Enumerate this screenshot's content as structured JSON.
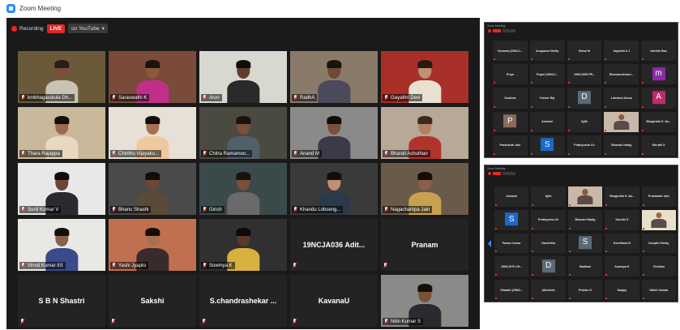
{
  "window": {
    "title": "Zoom Meeting"
  },
  "toolbar": {
    "recording_label": "Recording",
    "live_label": "LIVE",
    "stream_label": "on YouTube",
    "stream_caret": "▾"
  },
  "colors": {
    "accent": "#2D8CFF",
    "live": "#e02828",
    "active_border": "#e6d64a",
    "tile_bg": "#232323"
  },
  "gallery": [
    {
      "name": "kmbhagavatula Dh...",
      "video": true,
      "bg": "#6b5a3a",
      "skin": "#7a5036",
      "shirt": "#c9c2b6",
      "hair": "#2a1e16",
      "active": true
    },
    {
      "name": "Saraswathi K",
      "video": true,
      "bg": "#7a4a3a",
      "skin": "#8a5a3a",
      "shirt": "#c0308a",
      "hair": "#1a120e"
    },
    {
      "name": "Arun",
      "video": true,
      "bg": "#d8d8d0",
      "skin": "#5e3e2a",
      "shirt": "#2a2a2a",
      "hair": "#120c08"
    },
    {
      "name": "RadhA",
      "video": true,
      "bg": "#8a7a6a",
      "skin": "#6e4a34",
      "shirt": "#4a4a5a",
      "hair": "#1a140e"
    },
    {
      "name": "Gayathri Devi",
      "video": true,
      "bg": "#a83028",
      "skin": "#c09070",
      "shirt": "#e8e0d0",
      "hair": "#2a1a14"
    },
    {
      "name": "Thara Rajappa",
      "video": true,
      "bg": "#c9b89a",
      "skin": "#9a6a4a",
      "shirt": "#e8d8c0",
      "hair": "#140e0a"
    },
    {
      "name": "Chinthu Vijayaku...",
      "video": true,
      "bg": "#e6e0d6",
      "skin": "#a87050",
      "shirt": "#f0c8a0",
      "hair": "#140e0a"
    },
    {
      "name": "Chitra Ramamoo...",
      "video": true,
      "bg": "#4a4a40",
      "skin": "#7a5038",
      "shirt": "#50606a",
      "hair": "#1a120c"
    },
    {
      "name": "Anand M",
      "video": true,
      "bg": "#8a8a88",
      "skin": "#7a5038",
      "shirt": "#3a3a48",
      "hair": "#120c08"
    },
    {
      "name": "Bharati Achuthan",
      "video": true,
      "bg": "#b8a898",
      "skin": "#b48060",
      "shirt": "#b0342c",
      "hair": "#3a2a22"
    },
    {
      "name": "Sunil Kumar V",
      "video": true,
      "bg": "#e8e8e8",
      "skin": "#6a4634",
      "shirt": "#2a2a30",
      "hair": "#120c08"
    },
    {
      "name": "Bhanu Shashi",
      "video": true,
      "bg": "#4a4a4a",
      "skin": "#6a4834",
      "shirt": "#5a4a3a",
      "hair": "#120c08"
    },
    {
      "name": "Girish",
      "video": true,
      "bg": "#3a4a4a",
      "skin": "#7a5038",
      "shirt": "#6a6a6a",
      "hair": "#1a120c"
    },
    {
      "name": "Khandu Lobseng...",
      "video": true,
      "bg": "#3a3a3a",
      "skin": "#c09070",
      "shirt": "#2a3a4a",
      "hair": "#140e0a"
    },
    {
      "name": "Nagachampa Jain",
      "video": true,
      "bg": "#6a5a4a",
      "skin": "#8a6048",
      "shirt": "#c8a050",
      "hair": "#140e0a"
    },
    {
      "name": "Vinod Kumar IIS",
      "video": true,
      "bg": "#e8e8e4",
      "skin": "#8a6048",
      "shirt": "#3a4a8a",
      "hair": "#140e0a"
    },
    {
      "name": "Yashi Jyapto",
      "video": true,
      "bg": "#c07050",
      "skin": "#a87050",
      "shirt": "#3a2a2a",
      "hair": "#140e0a"
    },
    {
      "name": "Sowmya K",
      "video": true,
      "bg": "#303030",
      "skin": "#5a3a26",
      "shirt": "#d8b040",
      "hair": "#0e0a08"
    },
    {
      "name": "19NCJA036 Adit...",
      "video": false
    },
    {
      "name": "Pranam",
      "video": false
    },
    {
      "name": "S B N Shastri",
      "video": false
    },
    {
      "name": "Sakshi",
      "video": false
    },
    {
      "name": "S.chandrashekar ...",
      "video": false
    },
    {
      "name": "KavanaU",
      "video": false
    },
    {
      "name": "Nitin Kumar S",
      "video": true,
      "bg": "#8a8a88",
      "skin": "#7a5038",
      "shirt": "#2a2a30",
      "hair": "#140e0a"
    }
  ],
  "thumbnails": [
    {
      "title": "Zoom Meeting",
      "tiles": [
        {
          "name": "Suvarna (20NCJ...",
          "kind": "name"
        },
        {
          "name": "Anupama Shetty",
          "kind": "name"
        },
        {
          "name": "Rahul M",
          "kind": "name"
        },
        {
          "name": "Jayanthi A J",
          "kind": "name"
        },
        {
          "name": "Karthik Rao",
          "kind": "name"
        },
        {
          "name": "Priya",
          "kind": "name"
        },
        {
          "name": "Pujari (19NCJ...",
          "kind": "name"
        },
        {
          "name": "19NCJ055 PR...",
          "kind": "name"
        },
        {
          "name": "Bhuvaneshwari...",
          "kind": "name"
        },
        {
          "letter": "m",
          "kind": "avatar",
          "color": "#8a2aa8"
        },
        {
          "name": "Sushma",
          "kind": "name"
        },
        {
          "name": "Kishor Raj",
          "kind": "name"
        },
        {
          "letter": "D",
          "kind": "avatar",
          "color": "#5a6a78"
        },
        {
          "name": "Lakshmi Aruna",
          "kind": "name"
        },
        {
          "letter": "A",
          "kind": "avatar",
          "color": "#c02a6a"
        },
        {
          "letter": "P",
          "kind": "avatar",
          "color": "#8a6a5a"
        },
        {
          "name": "Ashwini",
          "kind": "name"
        },
        {
          "name": "Ajith",
          "kind": "name"
        },
        {
          "kind": "photo",
          "bg": "#c8b8a8",
          "skin": "#8a5a3a"
        },
        {
          "name": "Bhagirathi K Jai...",
          "kind": "name"
        },
        {
          "name": "Prashanth Jain",
          "kind": "name"
        },
        {
          "letter": "S",
          "kind": "avatar",
          "color": "#1a6ac8"
        },
        {
          "name": "Prathyusha Ch",
          "kind": "name"
        },
        {
          "name": "Bhavani Nadig",
          "kind": "name"
        },
        {
          "name": "Shruthi S",
          "kind": "name"
        }
      ]
    },
    {
      "title": "Zoom Meeting",
      "tiles": [
        {
          "name": "Ashwini",
          "kind": "name"
        },
        {
          "name": "Ajith",
          "kind": "name"
        },
        {
          "kind": "photo",
          "bg": "#c8b8a8",
          "skin": "#8a5a3a"
        },
        {
          "name": "Bhagirathi K Jai...",
          "kind": "name"
        },
        {
          "name": "Prashanth Jain",
          "kind": "name"
        },
        {
          "letter": "S",
          "kind": "avatar",
          "color": "#1a6ac8"
        },
        {
          "name": "Prathyusha Ch",
          "kind": "name"
        },
        {
          "name": "Bhavani Nadig",
          "kind": "name"
        },
        {
          "name": "Shruthi S",
          "kind": "name"
        },
        {
          "kind": "photo",
          "bg": "#e8e0c8",
          "skin": "#9a6a4a"
        },
        {
          "name": "Pavan Kumar",
          "kind": "name"
        },
        {
          "name": "Harshitha",
          "kind": "name"
        },
        {
          "letter": "S",
          "kind": "avatar",
          "color": "#5a6a78"
        },
        {
          "name": "Keerthana R",
          "kind": "name"
        },
        {
          "name": "Deepthi Shetty",
          "kind": "name"
        },
        {
          "name": "19NCJ076 CH...",
          "kind": "name"
        },
        {
          "letter": "D",
          "kind": "avatar",
          "color": "#5a6a78"
        },
        {
          "name": "Madhavi",
          "kind": "name"
        },
        {
          "name": "Sowmya K",
          "kind": "name"
        },
        {
          "name": "Chethan",
          "kind": "name"
        },
        {
          "name": "Sharath (19NC...",
          "kind": "name"
        },
        {
          "name": "Abhishek",
          "kind": "name"
        },
        {
          "name": "Prabhu G",
          "kind": "name"
        },
        {
          "name": "Sanjay",
          "kind": "name"
        },
        {
          "name": "Nikhil Gowda",
          "kind": "name"
        }
      ]
    }
  ]
}
